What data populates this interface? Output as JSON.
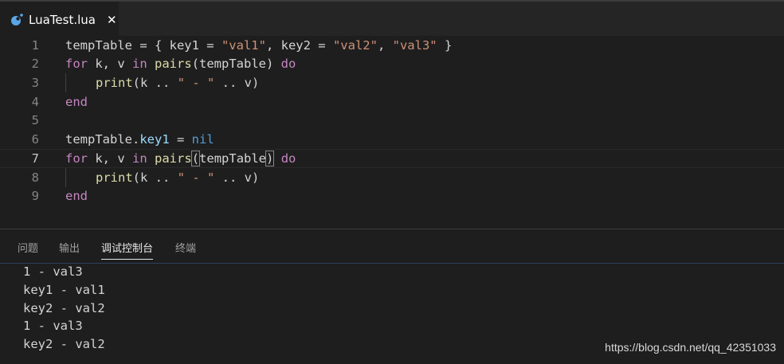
{
  "tab": {
    "title": "LuaTest.lua",
    "close_glyph": "✕",
    "icon": "lua-icon"
  },
  "editor": {
    "line_numbers": [
      "1",
      "2",
      "3",
      "4",
      "5",
      "6",
      "7",
      "8",
      "9"
    ],
    "active_line": "7"
  },
  "code": {
    "l1": {
      "a": "tempTable = { key1 = ",
      "b": "\"val1\"",
      "c": ", key2 = ",
      "d": "\"val2\"",
      "e": ", ",
      "f": "\"val3\"",
      "g": " }"
    },
    "l2": {
      "kw1": "for",
      "a": " k, v ",
      "kw2": "in",
      "sp": " ",
      "fn": "pairs",
      "b": "(tempTable) ",
      "kw3": "do"
    },
    "l3": {
      "fn": "print",
      "a": "(k .. ",
      "str": "\" - \"",
      "b": " .. v)"
    },
    "l4": {
      "kw": "end"
    },
    "l6": {
      "a": "tempTable.",
      "prop": "key1",
      "b": " = ",
      "nil": "nil"
    },
    "l7": {
      "kw1": "for",
      "a": " k, v ",
      "kw2": "in",
      "sp": " ",
      "fn": "pairs",
      "lp": "(",
      "mid": "tempTable",
      "rp": ")",
      "b": " ",
      "kw3": "do"
    },
    "l8": {
      "fn": "print",
      "a": "(k .. ",
      "str": "\" - \"",
      "b": " .. v)"
    },
    "l9": {
      "kw": "end"
    }
  },
  "panel": {
    "tabs": [
      "问题",
      "输出",
      "调试控制台",
      "终端"
    ],
    "active_tab": "调试控制台",
    "output": [
      "1 - val3",
      "key1 - val1",
      "key2 - val2",
      "1 - val3",
      "key2 - val2"
    ]
  },
  "watermark": "https://blog.csdn.net/qq_42351033",
  "colors": {
    "keyword": "#c586c0",
    "function": "#dcdcaa",
    "string": "#ce9178",
    "property": "#9cdcfe",
    "constant": "#569cd6",
    "text": "#d4d4d4"
  }
}
